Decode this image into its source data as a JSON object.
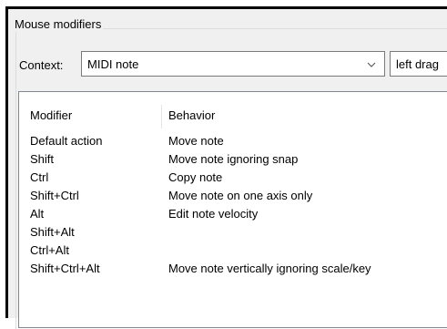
{
  "group": {
    "title": "Mouse modifiers"
  },
  "context": {
    "label": "Context:",
    "selected": "MIDI note",
    "action_selected": "left drag"
  },
  "table": {
    "columns": [
      "Modifier",
      "Behavior"
    ],
    "rows": [
      {
        "modifier": "Default action",
        "behavior": "Move note"
      },
      {
        "modifier": "Shift",
        "behavior": "Move note ignoring snap"
      },
      {
        "modifier": "Ctrl",
        "behavior": "Copy note"
      },
      {
        "modifier": "Shift+Ctrl",
        "behavior": "Move note on one axis only"
      },
      {
        "modifier": "Alt",
        "behavior": "Edit note velocity"
      },
      {
        "modifier": "Shift+Alt",
        "behavior": ""
      },
      {
        "modifier": "Ctrl+Alt",
        "behavior": ""
      },
      {
        "modifier": "Shift+Ctrl+Alt",
        "behavior": "Move note vertically ignoring scale/key"
      }
    ]
  },
  "icons": {
    "dropdown": "chevron-down-icon"
  }
}
